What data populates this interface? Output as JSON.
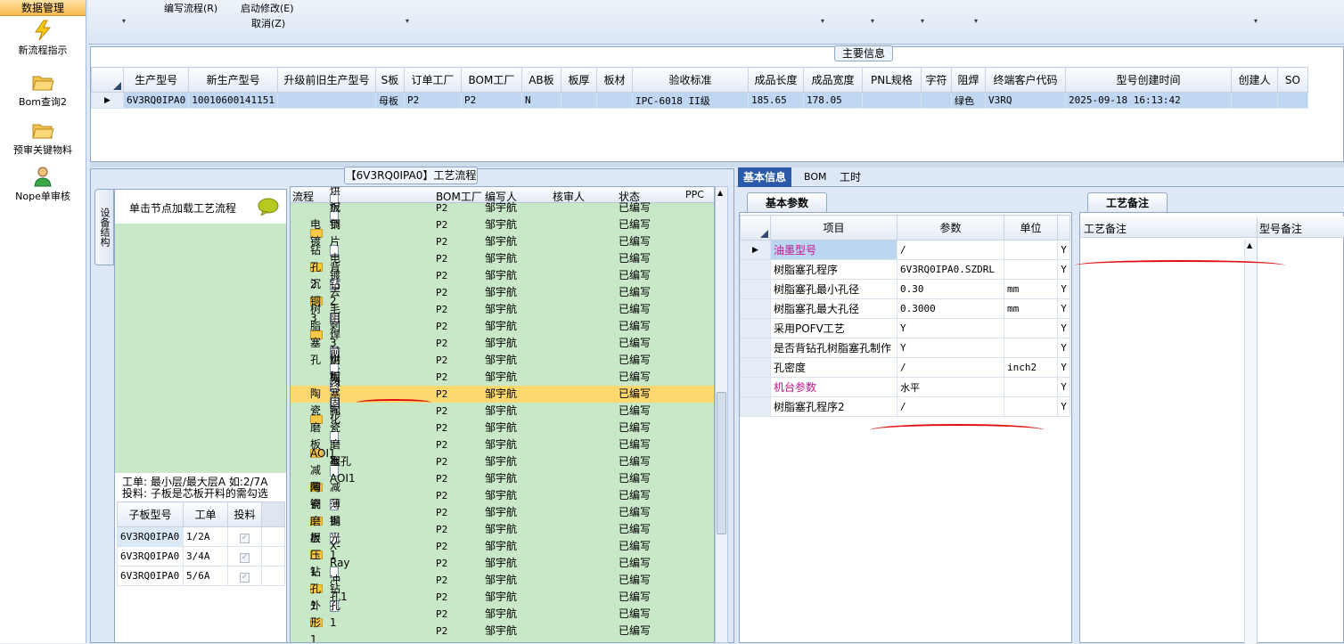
{
  "left_panel": {
    "header": "数据管理",
    "items": [
      {
        "label": "新流程指示",
        "icon": "lightning-icon"
      },
      {
        "label": "Bom查询2",
        "icon": "folder-open-icon"
      },
      {
        "label": "预审关键物料",
        "icon": "folder-open-icon"
      },
      {
        "label": "Nope单审核",
        "icon": "user-icon"
      }
    ]
  },
  "toolbar": {
    "edit_flow": "编写流程(R)",
    "start_modify": "启动修改(E)",
    "cancel": "取消(Z)"
  },
  "main_info": {
    "title": "主要信息",
    "columns": [
      "生产型号",
      "新生产型号",
      "升级前旧生产型号",
      "S板",
      "订单工厂",
      "BOM工厂",
      "AB板",
      "板厚",
      "板材",
      "验收标准",
      "成品长度",
      "成品宽度",
      "PNL规格",
      "字符",
      "阻焊",
      "终端客户代码",
      "型号创建时间",
      "创建人",
      "SO"
    ],
    "row": [
      "6V3RQ0IPA0",
      "10010600141151",
      "",
      "母板",
      "P2",
      "P2",
      "N",
      "",
      "",
      "IPC-6018 II级",
      "185.65",
      "178.05",
      "",
      "",
      "绿色",
      "V3RQ",
      "2025-09-18 16:13:42",
      "",
      ""
    ]
  },
  "flow_panel": {
    "title": "【6V3RQ0IPA0】工艺流程",
    "side_tab": "设备结构",
    "node_hint": "单击节点加载工艺流程",
    "note_line1": "工单: 最小层/最大层A 如:2/7A",
    "note_line2": "投料: 子板是芯板开料的需勾选",
    "sub_columns": [
      "子板型号",
      "工单",
      "投料"
    ],
    "sub_rows": [
      {
        "model": "6V3RQ0IPA0",
        "order": "1/2A",
        "feed": true
      },
      {
        "model": "6V3RQ0IPA0",
        "order": "3/4A",
        "feed": true
      },
      {
        "model": "6V3RQ0IPA0",
        "order": "5/6A",
        "feed": true
      }
    ],
    "tree_columns": [
      "流程",
      "BOM工厂",
      "编写人",
      "核审人",
      "状态",
      "PPC"
    ],
    "tree_rows": [
      {
        "name": "烘板",
        "kind": "doc",
        "level": 2,
        "bom": "P2",
        "author": "邹宇航",
        "status": "已编写"
      },
      {
        "name": "沉铜",
        "kind": "doc",
        "level": 2,
        "bom": "P2",
        "author": "邹宇航",
        "status": "已编写"
      },
      {
        "name": "电镀",
        "kind": "folder",
        "level": 1,
        "bom": "P2",
        "author": "邹宇航",
        "status": "已编写"
      },
      {
        "name": "负片电镀",
        "kind": "doc",
        "level": 2,
        "bom": "P2",
        "author": "邹宇航",
        "status": "已编写"
      },
      {
        "name": "钻孔2",
        "kind": "folder",
        "level": 1,
        "bom": "P2",
        "author": "邹宇航",
        "status": "已编写"
      },
      {
        "name": "背钻2",
        "kind": "doc",
        "level": 2,
        "bom": "P2",
        "author": "邹宇航",
        "status": "已编写"
      },
      {
        "name": "沉铜3",
        "kind": "folder",
        "level": 1,
        "bom": "P2",
        "author": "邹宇航",
        "status": "已编写"
      },
      {
        "name": "去毛刺3",
        "kind": "doc",
        "level": 2,
        "bom": "P2",
        "author": "邹宇航",
        "status": "已编写"
      },
      {
        "name": "树脂塞孔",
        "kind": "folder",
        "level": 1,
        "bom": "P2",
        "author": "邹宇航",
        "status": "已编写"
      },
      {
        "name": "阻焊前处理",
        "kind": "doc",
        "level": 2,
        "bom": "P2",
        "author": "邹宇航",
        "status": "已编写"
      },
      {
        "name": "烘板",
        "kind": "doc",
        "level": 2,
        "bom": "P2",
        "author": "邹宇航",
        "status": "已编写"
      },
      {
        "name": "树脂塞孔",
        "kind": "doc",
        "level": 2,
        "bom": "P2",
        "author": "邹宇航",
        "status": "已编写",
        "selected": true
      },
      {
        "name": "终固化",
        "kind": "doc",
        "level": 2,
        "bom": "P2",
        "author": "邹宇航",
        "status": "已编写"
      },
      {
        "name": "陶瓷磨板",
        "kind": "folder",
        "level": 1,
        "bom": "P2",
        "author": "邹宇航",
        "status": "已编写"
      },
      {
        "name": "陶瓷磨板",
        "kind": "doc",
        "level": 2,
        "bom": "P2",
        "author": "邹宇航",
        "status": "已编写"
      },
      {
        "name": "AOI1",
        "kind": "folder",
        "level": 1,
        "bom": "P2",
        "author": "邹宇航",
        "status": "已编写"
      },
      {
        "name": "塞孔AOI1",
        "kind": "doc",
        "level": 2,
        "bom": "P2",
        "author": "邹宇航",
        "status": "已编写"
      },
      {
        "name": "减薄铜",
        "kind": "folder",
        "level": 1,
        "bom": "P2",
        "author": "邹宇航",
        "status": "已编写"
      },
      {
        "name": "减薄铜",
        "kind": "doc",
        "level": 2,
        "bom": "P2",
        "author": "邹宇航",
        "status": "已编写"
      },
      {
        "name": "陶瓷磨板1",
        "kind": "folder",
        "level": 1,
        "bom": "P2",
        "author": "邹宇航",
        "status": "已编写"
      },
      {
        "name": "抛光1",
        "kind": "doc",
        "level": 2,
        "bom": "P2",
        "author": "邹宇航",
        "status": "已编写"
      },
      {
        "name": "层压1",
        "kind": "folder",
        "level": 1,
        "bom": "P2",
        "author": "邹宇航",
        "status": "已编写"
      },
      {
        "name": "X-Ray冲孔1",
        "kind": "doc",
        "level": 2,
        "bom": "P2",
        "author": "邹宇航",
        "status": "已编写"
      },
      {
        "name": "钻孔1",
        "kind": "folder",
        "level": 1,
        "bom": "P2",
        "author": "邹宇航",
        "status": "已编写"
      },
      {
        "name": "钻孔1",
        "kind": "doc",
        "level": 2,
        "bom": "P2",
        "author": "邹宇航",
        "status": "已编写"
      },
      {
        "name": "外形1",
        "kind": "folder",
        "level": 1,
        "bom": "P2",
        "author": "邹宇航",
        "status": "已编写"
      }
    ]
  },
  "right_panel": {
    "tabs": [
      "基本信息",
      "BOM",
      "工时"
    ],
    "basic_params_tab": "基本参数",
    "remarks_tab": "工艺备注",
    "param_columns": [
      "项目",
      "参数",
      "单位"
    ],
    "params": [
      {
        "item": "油墨型号",
        "value": "/",
        "unit": "",
        "flag": "Y",
        "highlight": true
      },
      {
        "item": "树脂塞孔程序",
        "value": "6V3RQ0IPA0.SZDRL",
        "unit": "",
        "flag": "Y"
      },
      {
        "item": "树脂塞孔最小孔径",
        "value": "0.30",
        "unit": "mm",
        "flag": "Y"
      },
      {
        "item": "树脂塞孔最大孔径",
        "value": "0.3000",
        "unit": "mm",
        "flag": "Y"
      },
      {
        "item": "采用POFV工艺",
        "value": "Y",
        "unit": "",
        "flag": "Y"
      },
      {
        "item": "是否背钻孔树脂塞孔制作",
        "value": "Y",
        "unit": "",
        "flag": "Y"
      },
      {
        "item": "孔密度",
        "value": "/",
        "unit": "inch2",
        "flag": "Y"
      },
      {
        "item": "机台参数",
        "value": "水平",
        "unit": "",
        "flag": "Y",
        "highlight": true
      },
      {
        "item": "树脂塞孔程序2",
        "value": "/",
        "unit": "",
        "flag": "Y"
      }
    ],
    "remark_columns": [
      "工艺备注",
      "型号备注"
    ]
  },
  "colors": {
    "tree_bg": "#c9e8c8",
    "selected_row": "#ffd970",
    "highlight_text": "#c0148c",
    "annotation": "#e01010"
  }
}
